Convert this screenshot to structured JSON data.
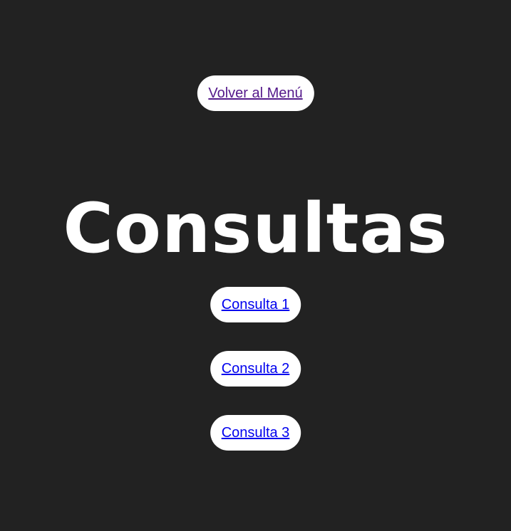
{
  "nav": {
    "back_label": "Volver al Menú"
  },
  "page": {
    "title": "Consultas"
  },
  "consultas": [
    {
      "label": "Consulta 1"
    },
    {
      "label": "Consulta 2"
    },
    {
      "label": "Consulta 3"
    }
  ],
  "colors": {
    "background": "#222222",
    "button_bg": "#ffffff",
    "link": "#0000ee",
    "visited_link": "#551a8b",
    "title": "#ffffff"
  }
}
